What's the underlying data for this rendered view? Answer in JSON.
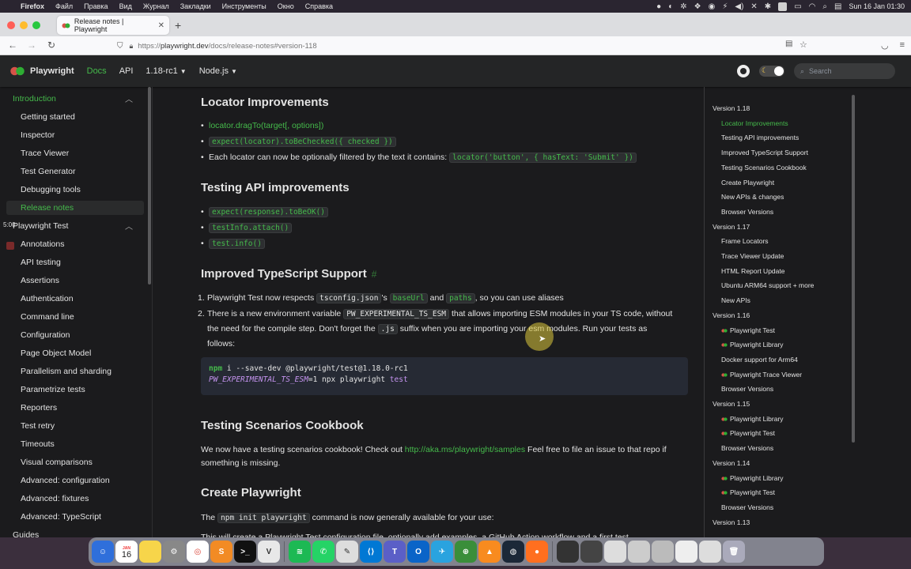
{
  "menubar": {
    "app": "Firefox",
    "items": [
      "Файл",
      "Правка",
      "Вид",
      "Журнал",
      "Закладки",
      "Инструменты",
      "Окно",
      "Справка"
    ],
    "clock": "Sun 16 Jan  01:30"
  },
  "browser": {
    "tab_title": "Release notes | Playwright",
    "url_prefix": "https://",
    "url_host": "playwright.dev",
    "url_path": "/docs/release-notes#version-118"
  },
  "site": {
    "brand": "Playwright",
    "nav": {
      "docs": "Docs",
      "api": "API",
      "version": "1.18-rc1",
      "lang": "Node.js"
    },
    "search_placeholder": "Search"
  },
  "sidebar": {
    "introduction": "Introduction",
    "intro_items": [
      "Getting started",
      "Inspector",
      "Trace Viewer",
      "Test Generator",
      "Debugging tools",
      "Release notes"
    ],
    "playwright_test": "Playwright Test",
    "pt_items": [
      "Annotations",
      "API testing",
      "Assertions",
      "Authentication",
      "Command line",
      "Configuration",
      "Page Object Model",
      "Parallelism and sharding",
      "Parametrize tests",
      "Reporters",
      "Test retry",
      "Timeouts",
      "Visual comparisons",
      "Advanced: configuration",
      "Advanced: fixtures",
      "Advanced: TypeScript"
    ],
    "guides": "Guides",
    "timer": "5:00"
  },
  "content": {
    "h_locator": "Locator Improvements",
    "loc_1": "locator.dragTo(target[, options])",
    "loc_2": "expect(locator).toBeChecked({ checked })",
    "loc_3_text": "Each locator can now be optionally filtered by the text it contains:",
    "loc_3_code": "locator('button', { hasText: 'Submit' })",
    "h_api": "Testing API improvements",
    "api_1": "expect(response).toBeOK()",
    "api_2": "testInfo.attach()",
    "api_3": "test.info()",
    "h_ts": "Improved TypeScript Support",
    "hash": "#",
    "ts_1_a": "Playwright Test now respects",
    "ts_1_code1": "tsconfig.json",
    "ts_1_b": "'s",
    "ts_1_code2": "baseUrl",
    "ts_1_c": "and",
    "ts_1_code3": "paths",
    "ts_1_d": ", so you can use aliases",
    "ts_2_a": "There is a new environment variable",
    "ts_2_code1": "PW_EXPERIMENTAL_TS_ESM",
    "ts_2_b": "that allows importing ESM modules in your TS code, without",
    "ts_2_c": "the need for the compile step. Don't forget the",
    "ts_2_code2": ".js",
    "ts_2_d": "suffix when you are importing your esm modules. Run your tests as",
    "ts_2_e": "follows:",
    "cb_l1_cmd": "npm",
    "cb_l1_rest": " i --save-dev @playwright/test@1.18.0-rc1",
    "cb_l2_var": "PW_EXPERIMENTAL_TS_ESM",
    "cb_l2_mid": "=1 npx playwright ",
    "cb_l2_end": "test",
    "h_cookbook": "Testing Scenarios Cookbook",
    "cook_a": "We now have a testing scenarios cookbook! Check out",
    "cook_link": "http://aka.ms/playwright/samples",
    "cook_b": "Feel free to file an issue to that repo if",
    "cook_c": "something is missing.",
    "h_create": "Create Playwright",
    "create_a": "The",
    "create_code": "npm init playwright",
    "create_b": "command is now generally available for your use:",
    "create_cut": "This will create a Playwright Test configuration file, optionally add examples, a GitHub Action workflow and a first test"
  },
  "toc": {
    "items": [
      {
        "label": "Version 1.18",
        "level": 0
      },
      {
        "label": "Locator Improvements",
        "level": 1,
        "active": true
      },
      {
        "label": "Testing API improvements",
        "level": 1
      },
      {
        "label": "Improved TypeScript Support",
        "level": 1
      },
      {
        "label": "Testing Scenarios Cookbook",
        "level": 1
      },
      {
        "label": "Create Playwright",
        "level": 1
      },
      {
        "label": "New APIs & changes",
        "level": 1
      },
      {
        "label": "Browser Versions",
        "level": 1
      },
      {
        "label": "Version 1.17",
        "level": 0
      },
      {
        "label": "Frame Locators",
        "level": 1
      },
      {
        "label": "Trace Viewer Update",
        "level": 1
      },
      {
        "label": "HTML Report Update",
        "level": 1
      },
      {
        "label": "Ubuntu ARM64 support + more",
        "level": 1
      },
      {
        "label": "New APIs",
        "level": 1
      },
      {
        "label": "Version 1.16",
        "level": 0
      },
      {
        "label": "Playwright Test",
        "level": 1,
        "icon": true
      },
      {
        "label": "Playwright Library",
        "level": 1,
        "icon": true
      },
      {
        "label": "Docker support for Arm64",
        "level": 1
      },
      {
        "label": "Playwright Trace Viewer",
        "level": 1,
        "icon": true
      },
      {
        "label": "Browser Versions",
        "level": 1
      },
      {
        "label": "Version 1.15",
        "level": 0
      },
      {
        "label": "Playwright Library",
        "level": 1,
        "icon": true
      },
      {
        "label": "Playwright Test",
        "level": 1,
        "icon": true
      },
      {
        "label": "Browser Versions",
        "level": 1
      },
      {
        "label": "Version 1.14",
        "level": 0
      },
      {
        "label": "Playwright Library",
        "level": 1,
        "icon": true
      },
      {
        "label": "Playwright Test",
        "level": 1,
        "icon": true
      },
      {
        "label": "Browser Versions",
        "level": 1
      },
      {
        "label": "Version 1.13",
        "level": 0
      }
    ]
  },
  "dock": {
    "calendar_month": "JAN",
    "calendar_day": "16"
  },
  "colors": {
    "accent": "#45ba4b",
    "background": "#1b1b1d",
    "navbar": "#242526"
  }
}
